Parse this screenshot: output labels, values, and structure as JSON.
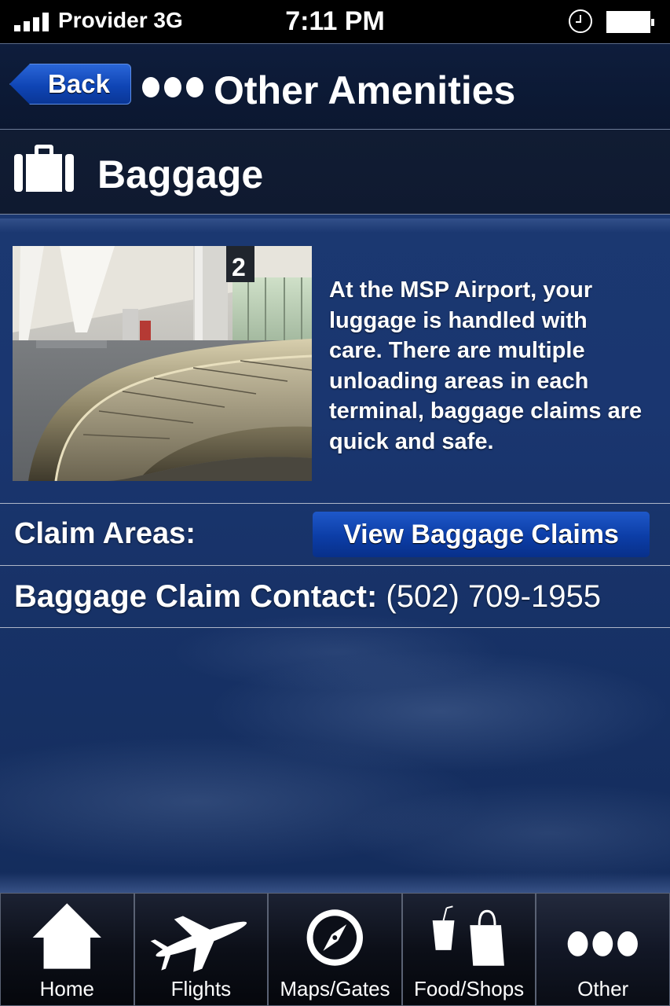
{
  "status_bar": {
    "carrier": "Provider 3G",
    "time": "7:11 PM"
  },
  "nav": {
    "back_label": "Back",
    "title": "Other Amenities"
  },
  "section": {
    "title": "Baggage",
    "icon": "suitcase-icon"
  },
  "info": {
    "photo_number": "2",
    "description": "At the MSP Airport, your luggage is handled with care. There are multiple unloading areas in each terminal, baggage claims are quick and safe."
  },
  "claims": {
    "label": "Claim Areas:",
    "button_label": "View Baggage Claims"
  },
  "contact": {
    "label": "Baggage Claim Contact:",
    "phone": "(502) 709-1955"
  },
  "tabs": [
    {
      "label": "Home",
      "icon": "home-icon"
    },
    {
      "label": "Flights",
      "icon": "airplane-icon"
    },
    {
      "label": "Maps/Gates",
      "icon": "compass-icon"
    },
    {
      "label": "Food/Shops",
      "icon": "food-shops-icon"
    },
    {
      "label": "Other",
      "icon": "more-dots-icon"
    }
  ],
  "colors": {
    "accent_button": "#0f45b5",
    "background": "#1a3670",
    "bar": "#0b1730"
  }
}
